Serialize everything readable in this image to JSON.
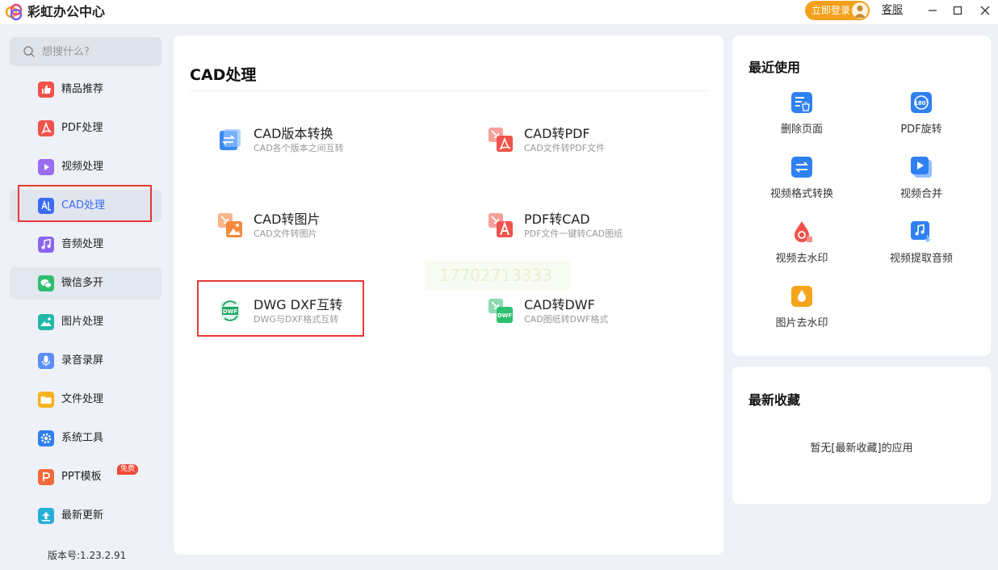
{
  "app": {
    "title": "彩虹办公中心"
  },
  "header": {
    "login_label": "立即登录",
    "service_label": "客服"
  },
  "sidebar": {
    "search_placeholder": "想搜什么?",
    "items": [
      {
        "label": "精品推荐",
        "icon": "thumbs-up-icon",
        "color": "#f0534b"
      },
      {
        "label": "PDF处理",
        "icon": "pdf-icon",
        "color": "#f0534b"
      },
      {
        "label": "视频处理",
        "icon": "video-icon",
        "color": "#9b6cf0"
      },
      {
        "label": "CAD处理",
        "icon": "cad-icon",
        "color": "#3a6cf4"
      },
      {
        "label": "音频处理",
        "icon": "music-icon",
        "color": "#8c64f0"
      },
      {
        "label": "微信多开",
        "icon": "wechat-icon",
        "color": "#2fbf71"
      },
      {
        "label": "图片处理",
        "icon": "image-icon",
        "color": "#20b8a8"
      },
      {
        "label": "录音录屏",
        "icon": "microphone-icon",
        "color": "#5b8ff5"
      },
      {
        "label": "文件处理",
        "icon": "folder-icon",
        "color": "#f5b21c"
      },
      {
        "label": "系统工具",
        "icon": "gear-icon",
        "color": "#2f80f0"
      },
      {
        "label": "PPT模板",
        "icon": "ppt-icon",
        "color": "#f26b3a",
        "badge": "免费"
      },
      {
        "label": "最新更新",
        "icon": "upload-icon",
        "color": "#27b0d6"
      }
    ],
    "version": "版本号:1.23.2.91"
  },
  "main": {
    "title": "CAD处理",
    "tools": [
      {
        "title": "CAD版本转换",
        "desc": "CAD各个版本之间互转",
        "icon": "convert-icon"
      },
      {
        "title": "CAD转PDF",
        "desc": "CAD文件转PDF文件",
        "icon": "cad-to-pdf-icon"
      },
      {
        "title": "CAD转图片",
        "desc": "CAD文件转图片",
        "icon": "cad-to-image-icon"
      },
      {
        "title": "PDF转CAD",
        "desc": "PDF文件一键转CAD图纸",
        "icon": "pdf-to-cad-icon"
      },
      {
        "title": "DWG DXF互转",
        "desc": "DWG与DXF格式互转",
        "icon": "dwg-dxf-icon"
      },
      {
        "title": "CAD转DWF",
        "desc": "CAD图纸转DWF格式",
        "icon": "cad-to-dwf-icon"
      }
    ],
    "watermark": "17702713333"
  },
  "recent": {
    "title": "最近使用",
    "items": [
      {
        "label": "删除页面",
        "icon": "delete-page-icon"
      },
      {
        "label": "PDF旋转",
        "icon": "rotate-180-icon"
      },
      {
        "label": "视频格式转换",
        "icon": "video-convert-icon"
      },
      {
        "label": "视频合并",
        "icon": "video-merge-icon"
      },
      {
        "label": "视频去水印",
        "icon": "video-watermark-icon"
      },
      {
        "label": "视频提取音频",
        "icon": "extract-audio-icon"
      },
      {
        "label": "图片去水印",
        "icon": "image-watermark-icon"
      }
    ]
  },
  "favorites": {
    "title": "最新收藏",
    "empty_text": "暂无[最新收藏]的应用"
  },
  "colors": {
    "accent": "#3a6cf4",
    "login": "#f2a01c",
    "highlight_border": "#e53935"
  }
}
